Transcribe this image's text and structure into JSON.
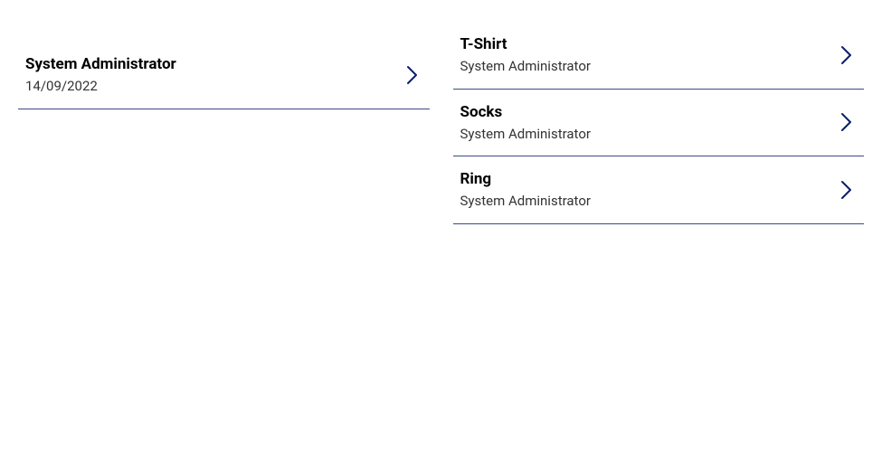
{
  "left": {
    "items": [
      {
        "title": "System Administrator",
        "subtitle": "14/09/2022"
      }
    ]
  },
  "right": {
    "items": [
      {
        "title": "T-Shirt",
        "subtitle": "System Administrator"
      },
      {
        "title": "Socks",
        "subtitle": "System Administrator"
      },
      {
        "title": "Ring",
        "subtitle": "System Administrator"
      }
    ]
  }
}
